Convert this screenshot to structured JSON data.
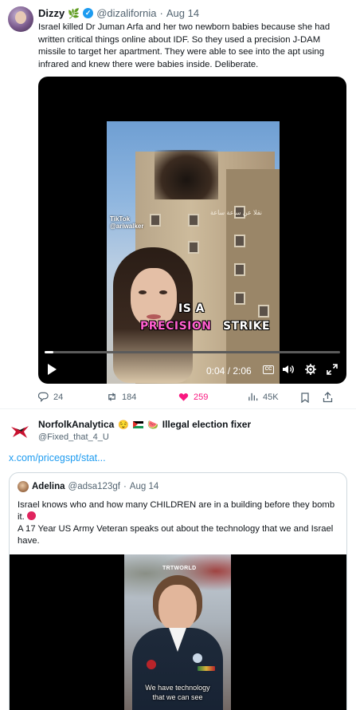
{
  "tweet1": {
    "author": "Dizzy",
    "handle": "@dizalifornia",
    "dot": "·",
    "date": "Aug 14",
    "text": "Israel killed Dr Juman Arfa and her two newborn babies because she had written critical things online about IDF. So they used a precision J-DAM missile to target her apartment. They were able to see into the apt using infrared and knew there were babies inside. Deliberate.",
    "video": {
      "caption_line1": "IS A",
      "caption_pink": "PRECISION",
      "caption_white": "STRIKE",
      "watermark_brand": "TikTok",
      "watermark_handle": "@ariwalker",
      "overlay_text": "نقلا عن ساعة ساعة",
      "time": "0:04 / 2:06",
      "cc_label": "CC",
      "progress_fraction": 0.03
    },
    "actions": {
      "replies": "24",
      "retweets": "184",
      "likes": "259",
      "views": "45K"
    }
  },
  "tweet2": {
    "author": "NorfolkAnalytica",
    "author_suffix": "Illegal election fixer",
    "handle": "@Fixed_that_4_U",
    "link": "x.com/pricegspt/stat...",
    "quote": {
      "author": "Adelina",
      "handle": "@adsa123gf",
      "dot": "·",
      "date": "Aug 14",
      "text_line1": "Israel knows who and how many CHILDREN are in a building before they bomb it.",
      "text_line2": "A 17 Year US Army Veteran speaks out about the technology that we and Israel have.",
      "video": {
        "watermark": "TRTWORLD",
        "subtitle_line1": "We have technology",
        "subtitle_line2": "that we can see"
      }
    }
  },
  "colors": {
    "accent": "#1d9bf0",
    "like": "#f91880",
    "muted": "#536471",
    "caption_pink": "#ff5fcf"
  }
}
